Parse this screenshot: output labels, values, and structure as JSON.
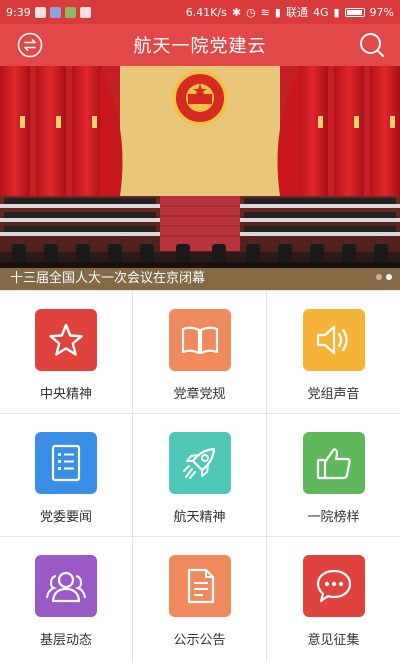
{
  "status_bar": {
    "time": "9:39",
    "speed": "6.41K/s",
    "carrier": "联通",
    "network": "4G",
    "battery": "97%"
  },
  "header": {
    "title": "航天一院党建云",
    "left_icon": "switch-icon",
    "right_icon": "search-icon"
  },
  "banner": {
    "caption": "十三届全国人大一次会议在京闭幕",
    "slide_count": 2,
    "active_slide": 2
  },
  "menu": [
    {
      "label": "中央精神",
      "icon": "star-icon",
      "color": "#e0423c"
    },
    {
      "label": "党章党规",
      "icon": "book-icon",
      "color": "#f08a5d"
    },
    {
      "label": "党组声音",
      "icon": "speaker-icon",
      "color": "#f5b437"
    },
    {
      "label": "党委要闻",
      "icon": "document-list-icon",
      "color": "#3a8ee6"
    },
    {
      "label": "航天精神",
      "icon": "rocket-icon",
      "color": "#4fc7b8"
    },
    {
      "label": "一院榜样",
      "icon": "thumbs-up-icon",
      "color": "#5fb85a"
    },
    {
      "label": "基层动态",
      "icon": "people-icon",
      "color": "#9b59c8"
    },
    {
      "label": "公示公告",
      "icon": "notice-icon",
      "color": "#f08a5d"
    },
    {
      "label": "意见征集",
      "icon": "chat-icon",
      "color": "#e0423c"
    }
  ]
}
